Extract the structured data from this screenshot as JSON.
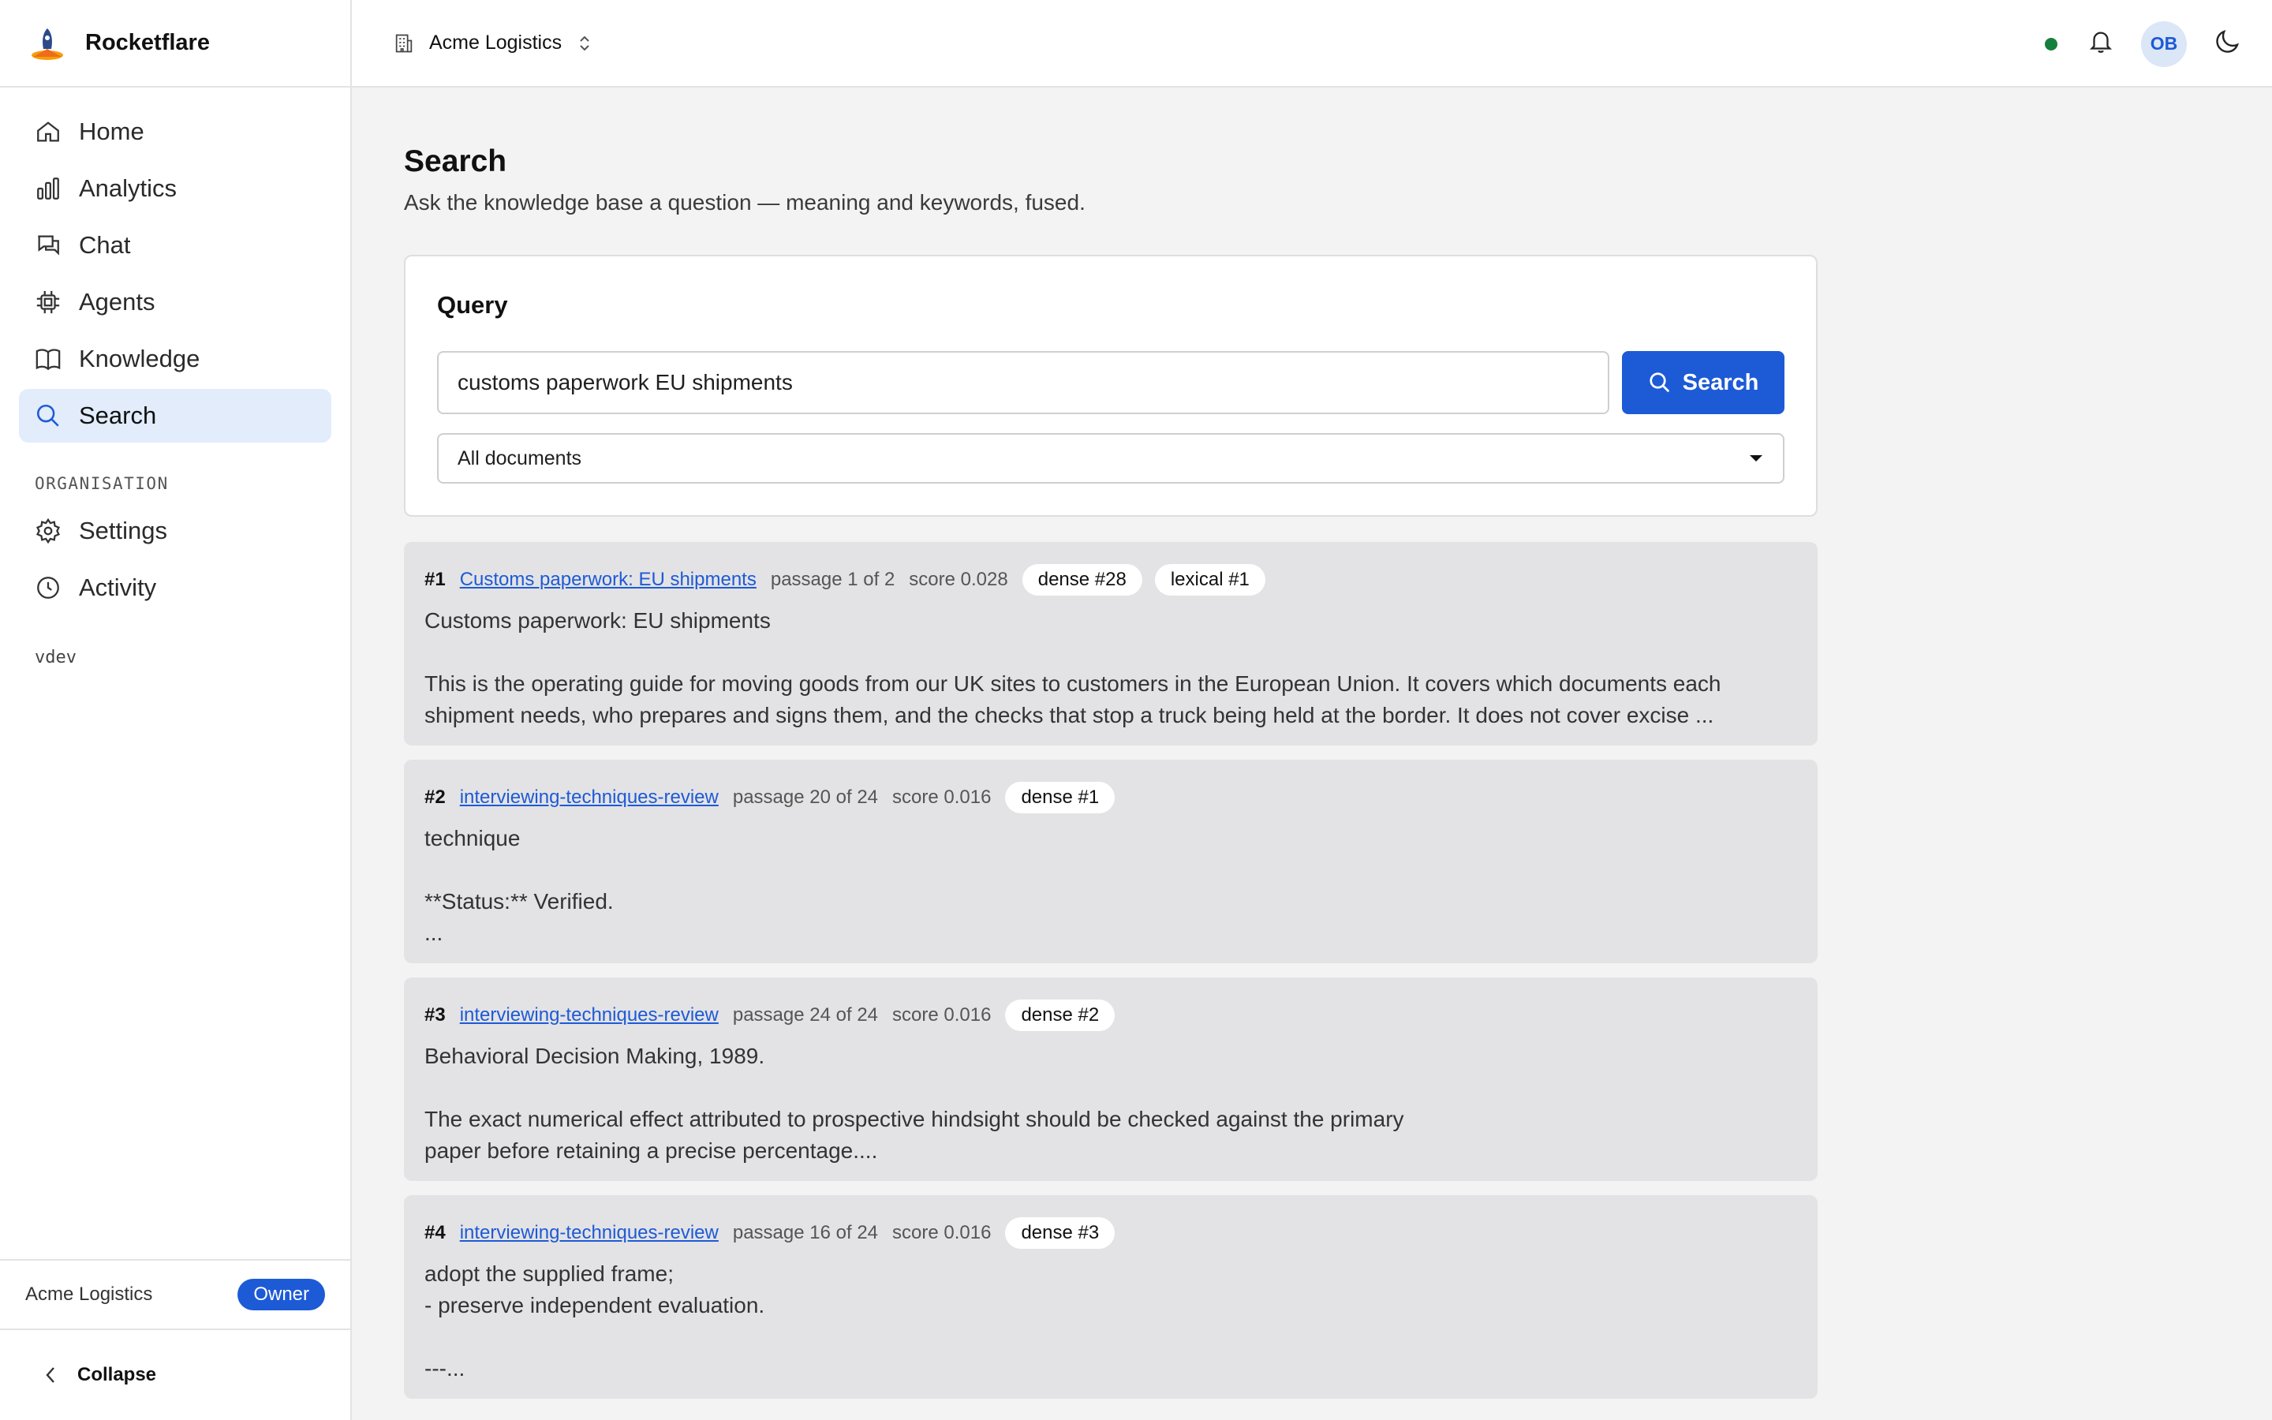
{
  "app": {
    "name": "Rocketflare",
    "version": "vdev"
  },
  "sidebar": {
    "items": [
      {
        "label": "Home",
        "icon": "home-icon"
      },
      {
        "label": "Analytics",
        "icon": "analytics-icon"
      },
      {
        "label": "Chat",
        "icon": "chat-icon"
      },
      {
        "label": "Agents",
        "icon": "chip-icon"
      },
      {
        "label": "Knowledge",
        "icon": "book-icon"
      },
      {
        "label": "Search",
        "icon": "search-icon",
        "active": true
      }
    ],
    "section_label": "ORGANISATION",
    "org_items": [
      {
        "label": "Settings",
        "icon": "gear-icon"
      },
      {
        "label": "Activity",
        "icon": "clock-icon"
      }
    ],
    "footer": {
      "org_name": "Acme Logistics",
      "role": "Owner",
      "collapse_label": "Collapse"
    }
  },
  "topbar": {
    "org_name": "Acme Logistics",
    "avatar_initials": "OB",
    "status_color": "#15803d"
  },
  "page": {
    "title": "Search",
    "subtitle": "Ask the knowledge base a question — meaning and keywords, fused."
  },
  "query": {
    "title": "Query",
    "value": "customs paperwork EU shipments",
    "button_label": "Search",
    "scope": "All documents"
  },
  "results": [
    {
      "rank": "#1",
      "doc": "Customs paperwork: EU shipments",
      "passage": "passage 1 of 2",
      "score": "score 0.028",
      "chips": [
        "dense #28",
        "lexical #1"
      ],
      "body": "Customs paperwork: EU shipments\n\nThis is the operating guide for moving goods from our UK sites to customers in the European Union. It covers which documents each shipment needs, who prepares and signs them, and the checks that stop a truck being held at the border. It does not cover excise ..."
    },
    {
      "rank": "#2",
      "doc": "interviewing-techniques-review",
      "passage": "passage 20 of 24",
      "score": "score 0.016",
      "chips": [
        "dense #1"
      ],
      "body": "technique\n\n**Status:** Verified.\n..."
    },
    {
      "rank": "#3",
      "doc": "interviewing-techniques-review",
      "passage": "passage 24 of 24",
      "score": "score 0.016",
      "chips": [
        "dense #2"
      ],
      "body": "Behavioral Decision Making, 1989.\n\nThe exact numerical effect attributed to prospective hindsight should be checked against the primary\npaper before retaining a precise percentage...."
    },
    {
      "rank": "#4",
      "doc": "interviewing-techniques-review",
      "passage": "passage 16 of 24",
      "score": "score 0.016",
      "chips": [
        "dense #3"
      ],
      "body": "adopt the supplied frame;\n- preserve independent evaluation.\n\n---..."
    }
  ],
  "colors": {
    "accent": "#1d5ad6",
    "active_nav_bg": "#e2ecfb",
    "result_bg": "#e3e3e5"
  }
}
